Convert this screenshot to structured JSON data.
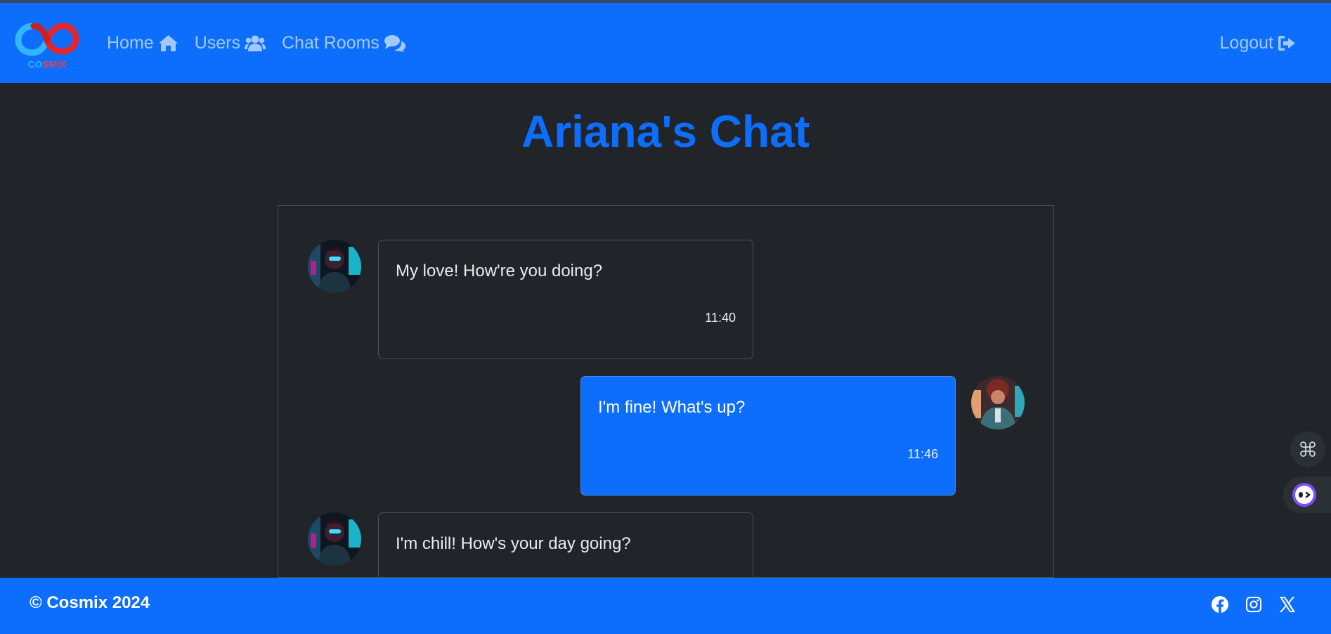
{
  "brand": {
    "logo_co": "CO",
    "logo_smix": "SMIX"
  },
  "nav": {
    "items": [
      {
        "label": "Home",
        "icon": "home-icon"
      },
      {
        "label": "Users",
        "icon": "users-icon"
      },
      {
        "label": "Chat Rooms",
        "icon": "comments-icon"
      }
    ],
    "logout": {
      "label": "Logout",
      "icon": "sign-out-icon"
    }
  },
  "page": {
    "title": "Ariana's Chat"
  },
  "messages": [
    {
      "direction": "received",
      "text": "My love! How're you doing?",
      "time": "11:40"
    },
    {
      "direction": "sent",
      "text": "I'm fine! What's up?",
      "time": "11:46"
    },
    {
      "direction": "received",
      "text": "I'm chill! How's your day going?",
      "time": ""
    }
  ],
  "footer": {
    "copyright": "© Cosmix 2024",
    "social": [
      "facebook-icon",
      "instagram-icon",
      "x-icon"
    ]
  },
  "colors": {
    "primary": "#0d6efd",
    "background": "#212529",
    "border": "#495057"
  }
}
